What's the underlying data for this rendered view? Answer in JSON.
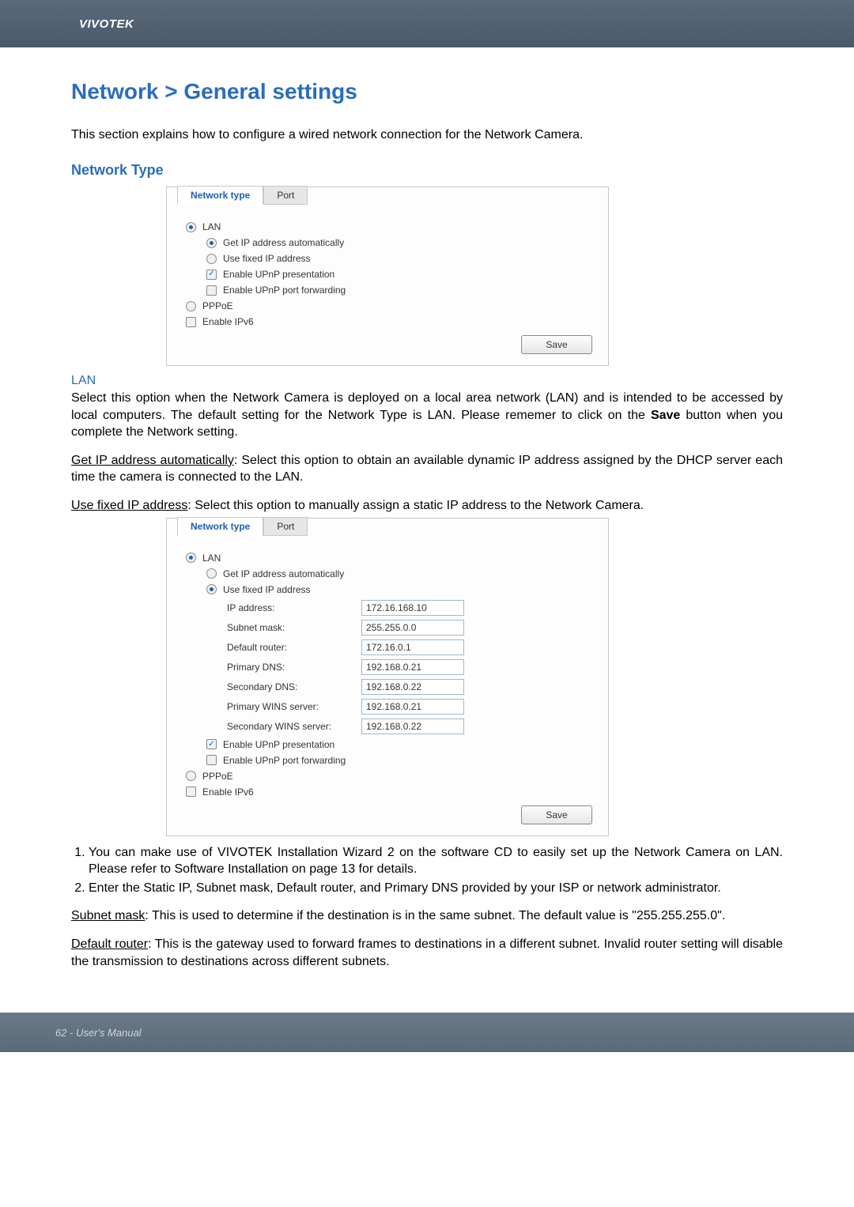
{
  "header": {
    "brand": "VIVOTEK"
  },
  "page": {
    "title": "Network > General settings",
    "intro": "This section explains how to configure a wired network connection for the Network Camera."
  },
  "nettype_heading": "Network Type",
  "panel_tabs": {
    "network_type": "Network type",
    "port": "Port"
  },
  "panel1": {
    "lan": "LAN",
    "get_auto": "Get IP address automatically",
    "use_fixed": "Use fixed IP address",
    "upnp_pres": "Enable UPnP presentation",
    "upnp_fwd": "Enable UPnP port forwarding",
    "pppoe": "PPPoE",
    "ipv6": "Enable IPv6",
    "save": "Save"
  },
  "lan_heading": "LAN",
  "lan_body": {
    "p1a": "Select this option when the Network Camera is deployed on a local area network (LAN) and is intended to be accessed by local computers. The default setting for the Network Type is LAN. Please rememer to click on the ",
    "p1_save": "Save",
    "p1b": " button when you complete the Network setting.",
    "p2_label": "Get IP address automatically",
    "p2": ": Select this option to obtain an available dynamic IP address assigned by the DHCP server each time the camera is connected to the LAN.",
    "p3_label": "Use fixed IP address",
    "p3": ": Select this option to manually assign a static IP address to the Network Camera."
  },
  "panel2": {
    "lan": "LAN",
    "get_auto": "Get IP address automatically",
    "use_fixed": "Use fixed IP address",
    "ip_label": "IP address:",
    "ip_val": "172.16.168.10",
    "sm_label": "Subnet mask:",
    "sm_val": "255.255.0.0",
    "dr_label": "Default router:",
    "dr_val": "172.16.0.1",
    "pdns_label": "Primary DNS:",
    "pdns_val": "192.168.0.21",
    "sdns_label": "Secondary DNS:",
    "sdns_val": "192.168.0.22",
    "pwins_label": "Primary WINS server:",
    "pwins_val": "192.168.0.21",
    "swins_label": "Secondary WINS server:",
    "swins_val": "192.168.0.22",
    "upnp_pres": "Enable UPnP presentation",
    "upnp_fwd": "Enable UPnP port forwarding",
    "pppoe": "PPPoE",
    "ipv6": "Enable IPv6",
    "save": "Save"
  },
  "list": {
    "li1": "You can make use of VIVOTEK Installation Wizard 2 on the software CD to easily set up the Network Camera on LAN. Please refer to Software Installation on page 13 for details.",
    "li2": "Enter the Static IP, Subnet mask, Default router, and Primary DNS provided by your ISP or network administrator."
  },
  "subnet": {
    "label": "Subnet mask",
    "text": ": This is used to determine if the destination is in the same subnet. The default value is \"255.255.255.0\"."
  },
  "defroute": {
    "label": "Default router",
    "text": ": This is the gateway used to forward frames to destinations in a different subnet. Invalid router setting will disable the transmission to destinations across different subnets."
  },
  "footer": {
    "text": "62 - User's Manual"
  }
}
